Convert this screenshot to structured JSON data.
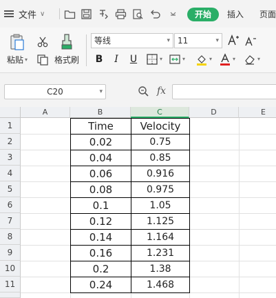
{
  "menubar": {
    "file_label": "文件",
    "tabs": [
      "开始",
      "插入",
      "页面"
    ]
  },
  "ribbon": {
    "paste_label": "粘贴",
    "format_painter_label": "格式刷",
    "font_name": "等线",
    "font_size": "11",
    "bold": "B",
    "italic": "I",
    "underline": "U"
  },
  "formula_bar": {
    "cell_ref": "C20",
    "fx": "fx",
    "formula": ""
  },
  "sheet": {
    "columns": [
      "A",
      "B",
      "C",
      "D",
      "E"
    ],
    "rows": [
      "1",
      "2",
      "3",
      "4",
      "5",
      "6",
      "7",
      "8",
      "9",
      "10",
      "11"
    ],
    "table": {
      "headers": [
        "Time",
        "Velocity"
      ],
      "rows": [
        [
          "0.02",
          "0.75"
        ],
        [
          "0.04",
          "0.85"
        ],
        [
          "0.06",
          "0.916"
        ],
        [
          "0.08",
          "0.975"
        ],
        [
          "0.1",
          "1.05"
        ],
        [
          "0.12",
          "1.125"
        ],
        [
          "0.14",
          "1.164"
        ],
        [
          "0.16",
          "1.231"
        ],
        [
          "0.2",
          "1.38"
        ],
        [
          "0.24",
          "1.468"
        ]
      ]
    }
  },
  "colors": {
    "accent": "#2aae67",
    "ribbon_bg": "#f7f7f7",
    "header_bg": "#eef0f3"
  }
}
